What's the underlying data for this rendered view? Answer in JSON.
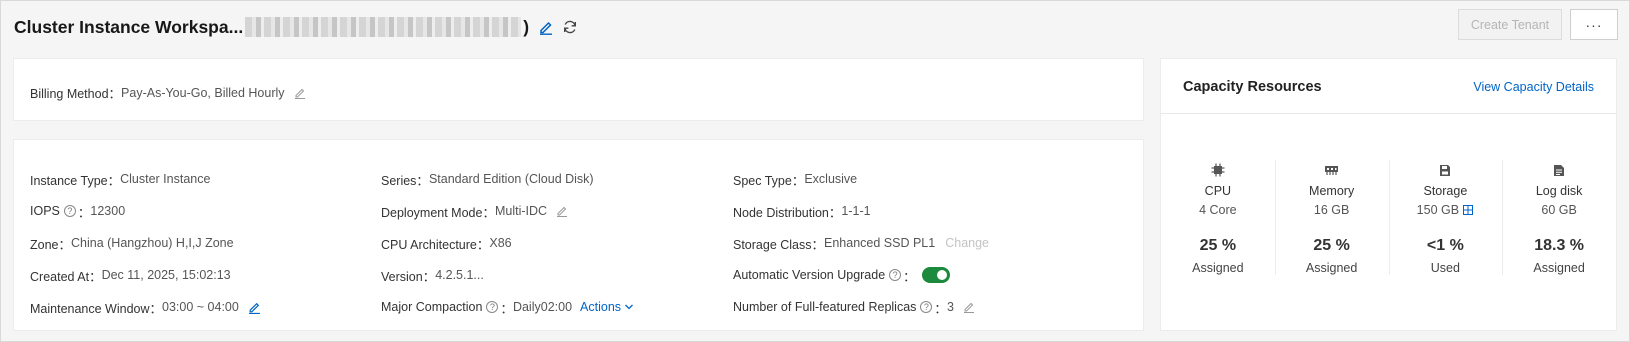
{
  "header": {
    "title": "Cluster Instance Workspa...",
    "title_close": ")",
    "create_tenant_label": "Create Tenant",
    "more_label": "···"
  },
  "billing": {
    "label": "Billing Method：",
    "value": "Pay-As-You-Go, Billed Hourly"
  },
  "info": {
    "col1": [
      {
        "label": "Instance Type：",
        "value": "Cluster Instance"
      },
      {
        "label": "IOPS",
        "help": "?",
        "sep": "：",
        "value": "12300"
      },
      {
        "label": "Zone：",
        "value": "China (Hangzhou) H,I,J Zone"
      },
      {
        "label": "Created At：",
        "value": "Dec 11, 2025, 15:02:13"
      },
      {
        "label": "Maintenance Window：",
        "value": "03:00 ~ 04:00"
      }
    ],
    "col2": [
      {
        "label": "Series：",
        "value": "Standard Edition (Cloud Disk)"
      },
      {
        "label": "Deployment Mode：",
        "value": "Multi-IDC"
      },
      {
        "label": "CPU Architecture：",
        "value": "X86"
      },
      {
        "label": "Version：",
        "value": "4.2.5.1..."
      },
      {
        "label": "Major Compaction",
        "help": "?",
        "sep": "：",
        "value": "Daily02:00",
        "action": "Actions"
      }
    ],
    "col3": [
      {
        "label": "Spec Type：",
        "value": "Exclusive"
      },
      {
        "label": "Node Distribution：",
        "value": "1-1-1"
      },
      {
        "label": "Storage Class：",
        "value": "Enhanced SSD PL1",
        "action": "Change"
      },
      {
        "label": "Automatic Version Upgrade",
        "help": "?",
        "sep": "：",
        "toggle": "on"
      },
      {
        "label": "Number of Full-featured Replicas",
        "help": "?",
        "sep": "：",
        "value": "3"
      }
    ]
  },
  "capacity": {
    "title": "Capacity Resources",
    "link": "View Capacity Details",
    "metrics": [
      {
        "icon": "cpu-icon",
        "name": "CPU",
        "value": "4  Core",
        "percent": "25 %",
        "state": "Assigned"
      },
      {
        "icon": "memory-icon",
        "name": "Memory",
        "value": "16  GB",
        "percent": "25 %",
        "state": "Assigned"
      },
      {
        "icon": "storage-icon",
        "name": "Storage",
        "value": "150  GB",
        "percent": "<1 %",
        "state": "Used"
      },
      {
        "icon": "log-disk-icon",
        "name": "Log disk",
        "value": "60  GB",
        "percent": "18.3 %",
        "state": "Assigned"
      }
    ]
  },
  "colors": {
    "link": "#0064c8",
    "toggle_on": "#1b8a3c"
  }
}
